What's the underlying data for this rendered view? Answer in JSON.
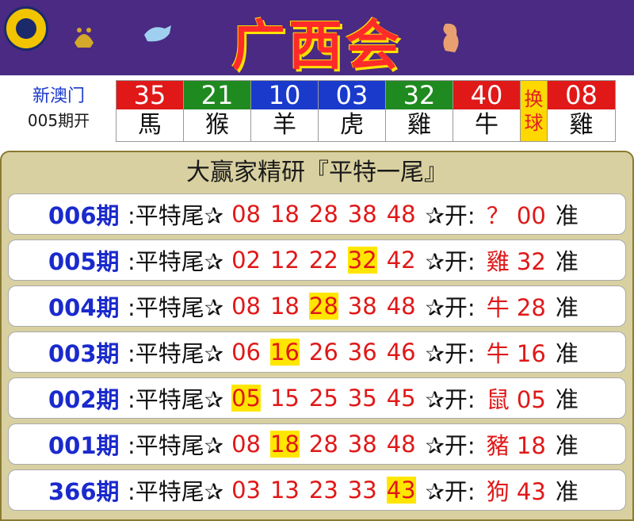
{
  "header": {
    "title": "广西会",
    "zodiac_icons": [
      "ox-icon",
      "dog-icon",
      "monkey-icon"
    ]
  },
  "draw": {
    "label": "新澳门",
    "issue": "005期开",
    "balls": [
      {
        "num": "35",
        "zodiac": "馬",
        "color": "#e01818"
      },
      {
        "num": "21",
        "zodiac": "猴",
        "color": "#1f8a1f"
      },
      {
        "num": "10",
        "zodiac": "羊",
        "color": "#1a3acc"
      },
      {
        "num": "03",
        "zodiac": "虎",
        "color": "#1a3acc"
      },
      {
        "num": "32",
        "zodiac": "雞",
        "color": "#1f8a1f"
      },
      {
        "num": "40",
        "zodiac": "牛",
        "color": "#e01818"
      }
    ],
    "swap_label": [
      "换",
      "球"
    ],
    "special": {
      "num": "08",
      "zodiac": "雞",
      "color": "#e01818"
    }
  },
  "panel": {
    "title": "大赢家精研『平特一尾』",
    "label": ":平特尾✰",
    "open_label": "✰开:",
    "zhun": "准",
    "rows": [
      {
        "period": "006期",
        "nums": [
          "08",
          "18",
          "28",
          "38",
          "48"
        ],
        "hl": -1,
        "result": "？ 00"
      },
      {
        "period": "005期",
        "nums": [
          "02",
          "12",
          "22",
          "32",
          "42"
        ],
        "hl": 3,
        "result": "雞 32"
      },
      {
        "period": "004期",
        "nums": [
          "08",
          "18",
          "28",
          "38",
          "48"
        ],
        "hl": 2,
        "result": "牛 28"
      },
      {
        "period": "003期",
        "nums": [
          "06",
          "16",
          "26",
          "36",
          "46"
        ],
        "hl": 1,
        "result": "牛 16"
      },
      {
        "period": "002期",
        "nums": [
          "05",
          "15",
          "25",
          "35",
          "45"
        ],
        "hl": 0,
        "result": "鼠 05"
      },
      {
        "period": "001期",
        "nums": [
          "08",
          "18",
          "28",
          "38",
          "48"
        ],
        "hl": 1,
        "result": "豬 18"
      },
      {
        "period": "366期",
        "nums": [
          "03",
          "13",
          "23",
          "33",
          "43"
        ],
        "hl": 4,
        "result": "狗 43"
      }
    ]
  }
}
